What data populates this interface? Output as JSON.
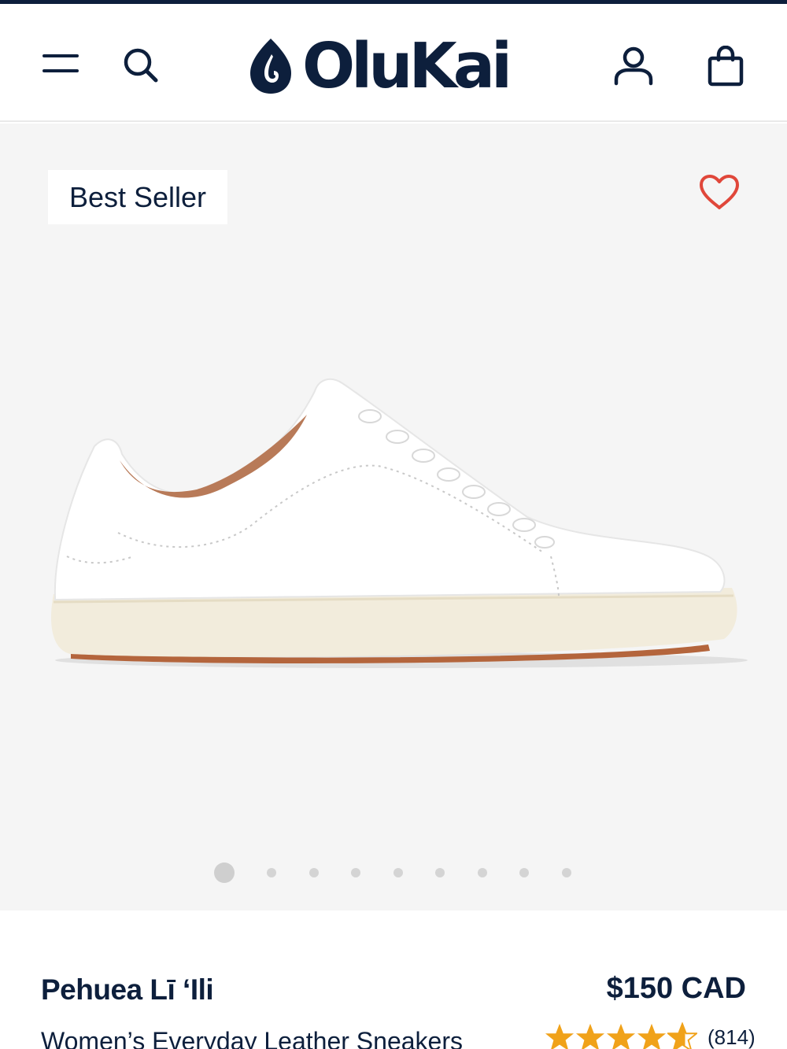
{
  "header": {
    "logo_text": "OluKai",
    "icons": [
      "menu-icon",
      "search-icon",
      "account-icon",
      "shopping-bag-icon"
    ]
  },
  "gallery": {
    "badge": "Best Seller",
    "wishlist_icon": "heart-icon",
    "image_count": 9,
    "active_index": 0
  },
  "product": {
    "name": "Pehuea Lī ʻIli",
    "price": "$150 CAD",
    "subtitle": "Women’s Everyday Leather Sneakers",
    "rating": 4.5,
    "review_count": "(814)"
  },
  "colors": {
    "navy": "#0d1f3c",
    "heart": "#e0473a",
    "star": "#f0a21a",
    "gallery_bg": "#f5f5f5"
  }
}
